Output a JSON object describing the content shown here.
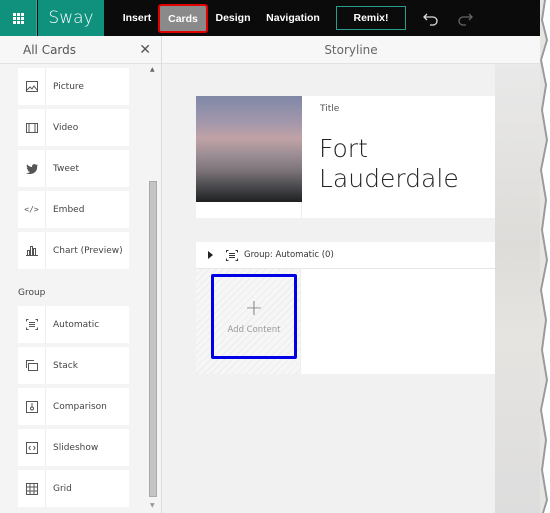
{
  "app": {
    "brand": "Sway",
    "brand_color": "#0f917e"
  },
  "topbar": {
    "tabs": [
      {
        "label": "Insert",
        "active": false
      },
      {
        "label": "Cards",
        "active": true
      },
      {
        "label": "Design",
        "active": false
      },
      {
        "label": "Navigation",
        "active": false
      }
    ],
    "remix_label": "Remix!",
    "icons": [
      "waffle-icon",
      "undo-icon",
      "redo-icon"
    ]
  },
  "left_panel": {
    "title": "All Cards",
    "close_icon": "close-icon",
    "media_items": [
      {
        "label": "Picture",
        "icon": "picture-icon"
      },
      {
        "label": "Video",
        "icon": "video-icon"
      },
      {
        "label": "Tweet",
        "icon": "twitter-icon"
      },
      {
        "label": "Embed",
        "icon": "embed-icon"
      },
      {
        "label": "Chart (Preview)",
        "icon": "chart-icon"
      }
    ],
    "group_heading": "Group",
    "group_items": [
      {
        "label": "Automatic",
        "icon": "automatic-icon"
      },
      {
        "label": "Stack",
        "icon": "stack-icon"
      },
      {
        "label": "Comparison",
        "icon": "comparison-icon"
      },
      {
        "label": "Slideshow",
        "icon": "slideshow-icon"
      },
      {
        "label": "Grid",
        "icon": "grid-icon"
      }
    ]
  },
  "main": {
    "title": "Storyline",
    "title_card": {
      "label": "Title",
      "text": "Fort Lauderdale"
    },
    "group_card": {
      "label": "Group: Automatic (0)",
      "add_content_label": "Add Content",
      "plus": "+"
    }
  }
}
